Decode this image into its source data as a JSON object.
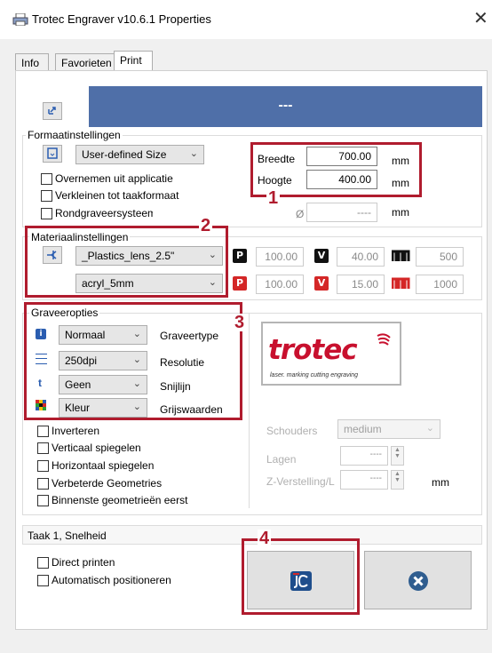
{
  "window": {
    "title": "Trotec Engraver v10.6.1 Properties",
    "close_glyph": "✕"
  },
  "tabs": [
    {
      "label": "Info"
    },
    {
      "label": "Favorieten"
    },
    {
      "label": "Print"
    }
  ],
  "header_bar": {
    "text": "---",
    "color": "#4f6fa8"
  },
  "format": {
    "title": "Formaatinstellingen",
    "size_select": "User-defined Size",
    "checkboxes": [
      "Overnemen uit applicatie",
      "Verkleinen tot taakformaat",
      "Rondgraveersysteem"
    ],
    "width_label": "Breedte",
    "width_value": "700.00",
    "height_label": "Hoogte",
    "height_value": "400.00",
    "unit": "mm",
    "diameter_symbol": "Ø",
    "diameter_value": "----"
  },
  "material": {
    "title": "Materiaalinstellingen",
    "material_select": "_Plastics_lens_2.5\"",
    "sub_select": "acryl_5mm",
    "row1": {
      "p": "100.00",
      "v": "40.00",
      "w": "500"
    },
    "row2": {
      "p": "100.00",
      "v": "15.00",
      "w": "1000"
    }
  },
  "engrave": {
    "title": "Graveeropties",
    "rows": [
      {
        "value": "Normaal",
        "label": "Graveertype"
      },
      {
        "value": "250dpi",
        "label": "Resolutie"
      },
      {
        "value": "Geen",
        "label": "Snijlijn"
      },
      {
        "value": "Kleur",
        "label": "Grijswaarden"
      }
    ],
    "checkboxes": [
      "Inverteren",
      "Verticaal spiegelen",
      "Horizontaal spiegelen",
      "Verbeterde Geometries",
      "Binnenste geometrieën eerst"
    ]
  },
  "logo": {
    "text": "trotec",
    "subtitle": "laser. marking cutting engraving",
    "color": "#c8102e"
  },
  "right_options": {
    "shoulders_label": "Schouders",
    "shoulders_value": "medium",
    "layers_label": "Lagen",
    "layers_value": "----",
    "z_label": "Z-Verstelling/L",
    "z_value": "----",
    "z_unit": "mm"
  },
  "job": {
    "label": "Taak 1, Snelheid",
    "checkboxes": [
      "Direct printen",
      "Automatisch positioneren"
    ]
  },
  "annotations": {
    "n1": "1",
    "n2": "2",
    "n3": "3",
    "n4": "4",
    "color": "#b01c2e"
  }
}
